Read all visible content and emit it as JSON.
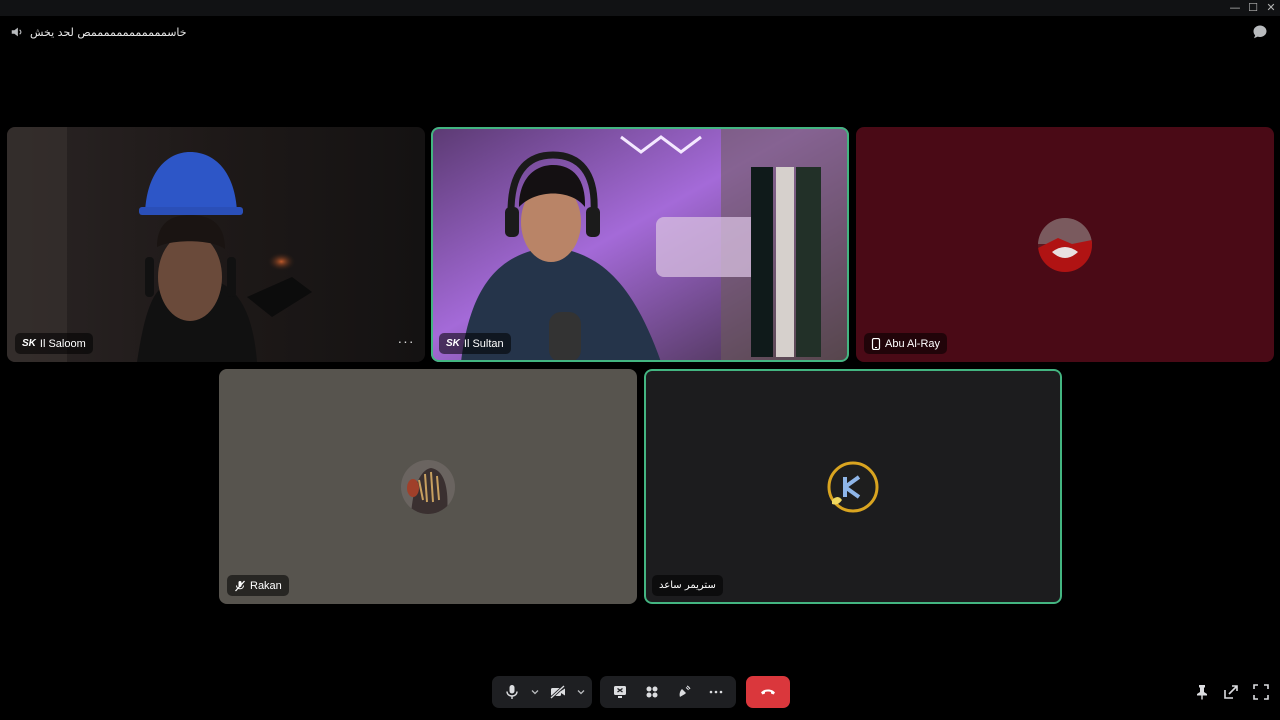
{
  "window": {
    "minimize_glyph": "—",
    "maximize_glyph": "☐",
    "close_glyph": "✕"
  },
  "channel": {
    "name": "خاسممممممممممممص لحد يخش",
    "icon": "speaker-icon"
  },
  "participants": [
    {
      "tag": "SK",
      "name": "Il Saloom",
      "icon": "",
      "video": true,
      "speaking": false
    },
    {
      "tag": "SK",
      "name": "Il Sultan",
      "icon": "",
      "video": true,
      "speaking": true
    },
    {
      "tag": "",
      "name": "Abu Al-Ray",
      "icon": "mobile-phone-icon",
      "video": false,
      "speaking": false,
      "bg": "#4a0a16"
    },
    {
      "tag": "",
      "name": "Rakan",
      "icon": "muted-mic-icon",
      "video": false,
      "speaking": false,
      "bg": "#57544e"
    },
    {
      "tag": "",
      "name": "ستريمر ساعد",
      "icon": "",
      "video": false,
      "speaking": true,
      "bg": "#1c1c1e"
    }
  ],
  "tile_menu": {
    "label": "···"
  },
  "colors": {
    "speaking_ring": "#43b581",
    "end_call": "#da373c",
    "control_bg": "#1e1f22"
  }
}
